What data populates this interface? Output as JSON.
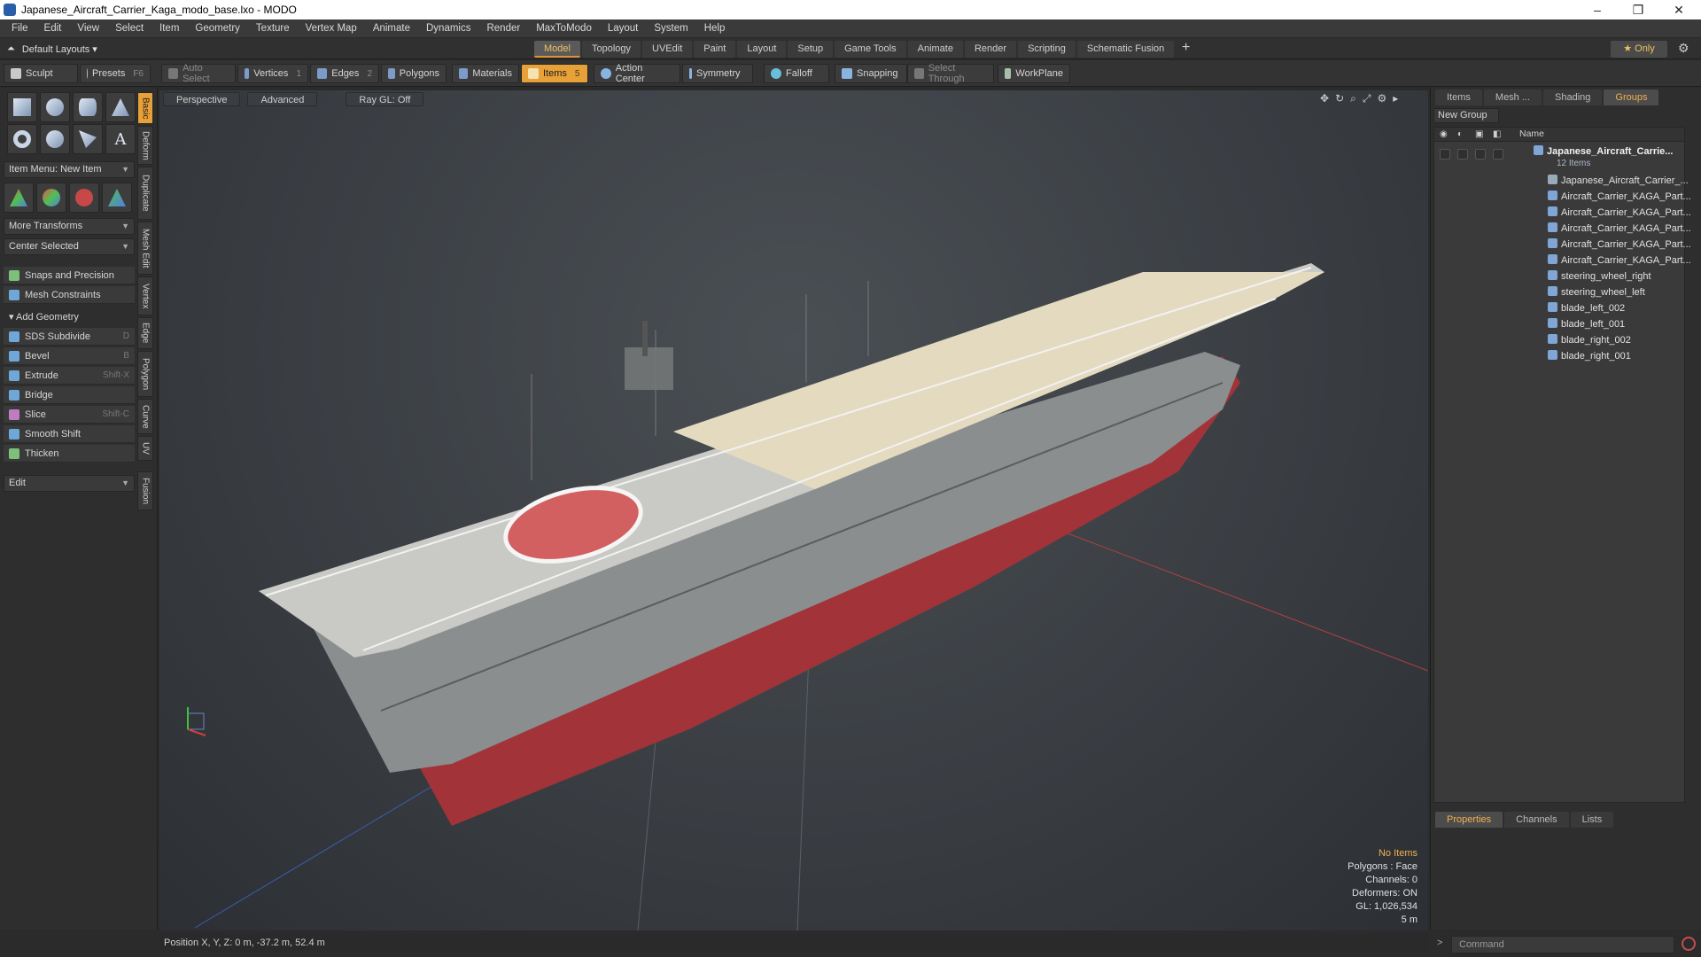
{
  "window": {
    "title": "Japanese_Aircraft_Carrier_Kaga_modo_base.lxo - MODO",
    "controls": [
      "–",
      "❐",
      "✕"
    ]
  },
  "menu": [
    "File",
    "Edit",
    "View",
    "Select",
    "Item",
    "Geometry",
    "Texture",
    "Vertex Map",
    "Animate",
    "Dynamics",
    "Render",
    "MaxToModo",
    "Layout",
    "System",
    "Help"
  ],
  "layoutbar": {
    "layout_select": "Default Layouts ▾",
    "tabs": [
      "Model",
      "Topology",
      "UVEdit",
      "Paint",
      "Layout",
      "Setup",
      "Game Tools",
      "Animate",
      "Render",
      "Scripting",
      "Schematic Fusion"
    ],
    "active_tab": "Model",
    "plus": "+",
    "only_label": "★  Only"
  },
  "toolbar": {
    "sculpt": "Sculpt",
    "presets": "Presets",
    "presets_key": "F6",
    "auto_select": "Auto Select",
    "vertices": "Vertices",
    "vertices_num": "1",
    "edges": "Edges",
    "edges_num": "2",
    "polygons": "Polygons",
    "materials": "Materials",
    "items": "Items",
    "items_num": "5",
    "action_center": "Action Center",
    "symmetry": "Symmetry",
    "falloff": "Falloff",
    "snapping": "Snapping",
    "select_through": "Select Through",
    "workplane": "WorkPlane"
  },
  "left": {
    "item_menu": "Item Menu: New Item",
    "more_transforms": "More Transforms",
    "center_selected": "Center Selected",
    "snaps": "Snaps and Precision",
    "mesh_constraints": "Mesh Constraints",
    "add_geometry": "Add Geometry",
    "tools": [
      {
        "label": "SDS Subdivide",
        "key": "D"
      },
      {
        "label": "Bevel",
        "key": "B"
      },
      {
        "label": "Extrude",
        "key": "Shift-X"
      },
      {
        "label": "Bridge",
        "key": ""
      },
      {
        "label": "Slice",
        "key": "Shift-C"
      },
      {
        "label": "Smooth Shift",
        "key": ""
      },
      {
        "label": "Thicken",
        "key": ""
      }
    ],
    "edit_dropdown": "Edit",
    "vtabs": [
      "Basic",
      "Deform",
      "Duplicate",
      "Mesh Edit",
      "Vertex",
      "Edge",
      "Polygon",
      "Curve",
      "UV",
      "Fusion"
    ]
  },
  "viewport": {
    "view_mode": "Perspective",
    "shading": "Advanced",
    "raygl": "Ray GL: Off",
    "info": {
      "no_items": "No Items",
      "polygons": "Polygons : Face",
      "channels": "Channels: 0",
      "deformers": "Deformers: ON",
      "gl": "GL: 1,026,534",
      "scale": "5 m"
    }
  },
  "status": {
    "position": "Position X, Y, Z:   0 m, -37.2 m, 52.4 m"
  },
  "right": {
    "tabs": [
      "Items",
      "Mesh ...",
      "Shading",
      "Groups"
    ],
    "active_tab": "Groups",
    "new_group": "New Group",
    "col_name": "Name",
    "root": "Japanese_Aircraft_Carrie...",
    "root_count": "12 Items",
    "items": [
      "Japanese_Aircraft_Carrier_...",
      "Aircraft_Carrier_KAGA_Part...",
      "Aircraft_Carrier_KAGA_Part...",
      "Aircraft_Carrier_KAGA_Part...",
      "Aircraft_Carrier_KAGA_Part...",
      "Aircraft_Carrier_KAGA_Part...",
      "steering_wheel_right",
      "steering_wheel_left",
      "blade_left_002",
      "blade_left_001",
      "blade_right_002",
      "blade_right_001"
    ],
    "bottom_tabs": [
      "Properties",
      "Channels",
      "Lists"
    ],
    "bottom_active": "Properties",
    "command_placeholder": "Command"
  },
  "colors": {
    "accent": "#e8a038",
    "hull_red": "#a8343a",
    "deck": "#e6dcc4"
  }
}
